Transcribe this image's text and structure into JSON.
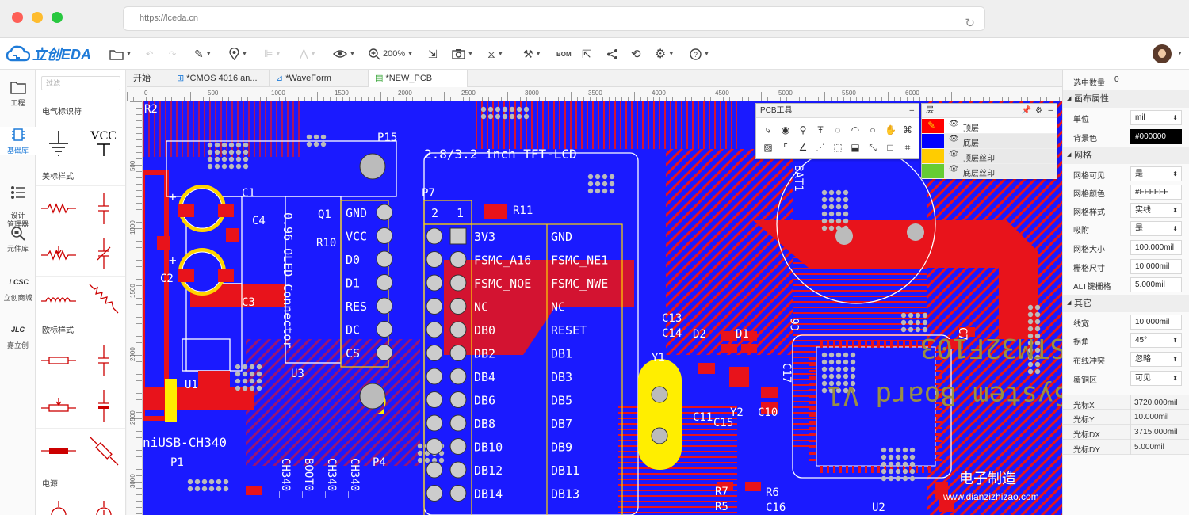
{
  "browser": {
    "url": "https://lceda.cn"
  },
  "app": {
    "logo_text": "立创EDA"
  },
  "toolbar": {
    "zoom": "200%",
    "bom": "BOM"
  },
  "rail": [
    {
      "label": "工程"
    },
    {
      "label": "基础库"
    },
    {
      "label": "设计\n管理器"
    },
    {
      "label": "元件库"
    },
    {
      "label": "立创商城"
    },
    {
      "label": "嘉立创"
    }
  ],
  "library": {
    "filter_placeholder": "过滤",
    "sections": [
      "电气标识符",
      "美标样式",
      "欧标样式",
      "电源"
    ],
    "vcc_label": "VCC"
  },
  "tabs": [
    {
      "label": "开始"
    },
    {
      "label": "*CMOS 4016 an..."
    },
    {
      "label": "*WaveForm"
    },
    {
      "label": "*NEW_PCB"
    }
  ],
  "ruler_labels": [
    "0",
    "500",
    "1000",
    "1500",
    "2000",
    "2500",
    "3000",
    "3500",
    "4000",
    "4500",
    "5000",
    "5500",
    "6000"
  ],
  "ruler_left_labels": [
    "500",
    "1000",
    "1500",
    "2000",
    "2500",
    "3000"
  ],
  "pcb_text": {
    "tft": "2.8/3.2 inch TFT-LCD",
    "p15": "P15",
    "p7": "P7",
    "p1": "P1",
    "p4": "P4",
    "r11": "R11",
    "r2": "R2",
    "c1": "C1",
    "c2": "C2",
    "c3": "C3",
    "c4": "C4",
    "q1": "Q1",
    "r10": "R10",
    "u1": "U1",
    "u3": "U3",
    "y1": "Y1",
    "y2": "Y2",
    "d1": "D1",
    "d2": "D2",
    "c6": "C6",
    "c7": "C7",
    "c10": "C10",
    "c11": "C11",
    "c13": "C13",
    "c14": "C14",
    "c15": "C15",
    "c16": "C16",
    "c17": "C17",
    "r5": "R5",
    "r6": "R6",
    "r7": "R7",
    "u2": "U2",
    "bat1": "BAT1",
    "oled": "0.96 OLED Connector",
    "usb": "niUSB-CH340",
    "oled_pins": [
      "GND",
      "VCC",
      "D0",
      "D1",
      "RES",
      "DC",
      "CS"
    ],
    "p7_hdr": [
      "2",
      "1"
    ],
    "p7_left": [
      "3V3",
      "FSMC_A16",
      "FSMC_NOE",
      "NC",
      "DB0",
      "DB2",
      "DB4",
      "DB6",
      "DB8",
      "DB10",
      "DB12",
      "DB14"
    ],
    "p7_right": [
      "GND",
      "FSMC_NE1",
      "FSMC_NWE",
      "NC",
      "RESET",
      "DB1",
      "DB3",
      "DB5",
      "DB7",
      "DB9",
      "DB11",
      "DB13"
    ],
    "usb_labels": [
      "CH340_",
      "BOOT0_",
      "CH340_",
      "CH340_"
    ],
    "stm": "STM32F103",
    "sys": "System Board V1"
  },
  "pcb_tools": {
    "title": "PCB工具"
  },
  "layers": {
    "title": "层",
    "items": [
      {
        "name": "顶层",
        "color": "#ff0000"
      },
      {
        "name": "底层",
        "color": "#0000ff"
      },
      {
        "name": "顶层丝印",
        "color": "#ffcc00"
      },
      {
        "name": "底层丝印",
        "color": "#66cc33"
      }
    ]
  },
  "props": {
    "selected_label": "选中数量",
    "selected_value": "0",
    "canvas_section": "画布属性",
    "unit_label": "单位",
    "unit_value": "mil",
    "bg_label": "背景色",
    "bg_value": "#000000",
    "grid_section": "网格",
    "grid_visible_label": "网格可见",
    "grid_visible_value": "是",
    "grid_color_label": "网格颜色",
    "grid_color_value": "#FFFFFF",
    "grid_style_label": "网格样式",
    "grid_style_value": "实线",
    "snap_label": "吸附",
    "snap_value": "是",
    "grid_size_label": "网格大小",
    "grid_size_value": "100.000mil",
    "grid_dim_label": "栅格尺寸",
    "grid_dim_value": "10.000mil",
    "alt_label": "ALT键栅格",
    "alt_value": "5.000mil",
    "other_section": "其它",
    "width_label": "线宽",
    "width_value": "10.000mil",
    "angle_label": "拐角",
    "angle_value": "45°",
    "conflict_label": "布线冲突",
    "conflict_value": "忽略",
    "copper_label": "覆铜区",
    "copper_value": "可见",
    "cursor": [
      {
        "label": "光标X",
        "value": "3720.000mil"
      },
      {
        "label": "光标Y",
        "value": "10.000mil"
      },
      {
        "label": "光标DX",
        "value": "3715.000mil"
      },
      {
        "label": "光标DY",
        "value": "5.000mil"
      }
    ]
  },
  "watermark": {
    "line1": "电子制造",
    "line2": "www.dianzizhizao.com"
  }
}
